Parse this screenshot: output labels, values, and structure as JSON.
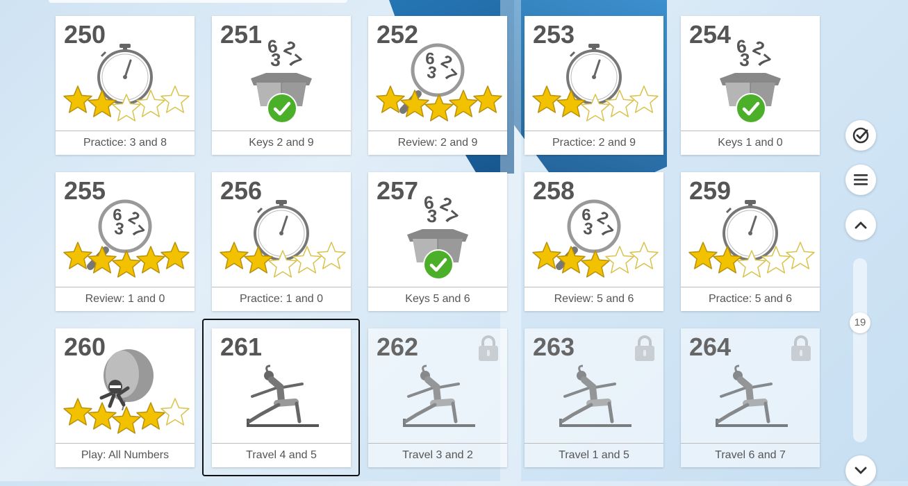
{
  "tiles": [
    {
      "number": "250",
      "label": "Practice: 3 and 8",
      "type": "stopwatch",
      "stars": 2,
      "locked": false
    },
    {
      "number": "251",
      "label": "Keys 2 and 9",
      "type": "box",
      "stars": 0,
      "locked": false
    },
    {
      "number": "252",
      "label": "Review: 2 and 9",
      "type": "magnifier",
      "stars": 5,
      "locked": false
    },
    {
      "number": "253",
      "label": "Practice: 2 and 9",
      "type": "stopwatch",
      "stars": 2,
      "locked": false
    },
    {
      "number": "254",
      "label": "Keys 1 and 0",
      "type": "box",
      "stars": 0,
      "locked": false
    },
    {
      "number": "255",
      "label": "Review: 1 and 0",
      "type": "magnifier",
      "stars": 5,
      "locked": false
    },
    {
      "number": "256",
      "label": "Practice: 1 and 0",
      "type": "stopwatch",
      "stars": 2,
      "locked": false
    },
    {
      "number": "257",
      "label": "Keys 5 and 6",
      "type": "box",
      "stars": 0,
      "locked": false
    },
    {
      "number": "258",
      "label": "Review: 5 and 6",
      "type": "magnifier",
      "stars": 3,
      "locked": false
    },
    {
      "number": "259",
      "label": "Practice: 5 and 6",
      "type": "stopwatch",
      "stars": 2,
      "locked": false
    },
    {
      "number": "260",
      "label": "Play: All Numbers",
      "type": "balloon",
      "stars": 4,
      "locked": false
    },
    {
      "number": "261",
      "label": "Travel 4 and 5",
      "type": "yoga",
      "stars": 0,
      "locked": false,
      "selected": true
    },
    {
      "number": "262",
      "label": "Travel 3 and 2",
      "type": "yoga",
      "stars": 0,
      "locked": true
    },
    {
      "number": "263",
      "label": "Travel 1 and 5",
      "type": "yoga",
      "stars": 0,
      "locked": true
    },
    {
      "number": "264",
      "label": "Travel 6 and 7",
      "type": "yoga",
      "stars": 0,
      "locked": true
    }
  ],
  "box_digits": "6237",
  "sidebar": {
    "buttons": [
      "check-icon",
      "menu-icon",
      "chevron-up-icon",
      "chevron-down-icon"
    ],
    "scroll_position": "19"
  },
  "colors": {
    "star": "#f2c200",
    "check": "#4caf2a",
    "number": "#555555"
  }
}
